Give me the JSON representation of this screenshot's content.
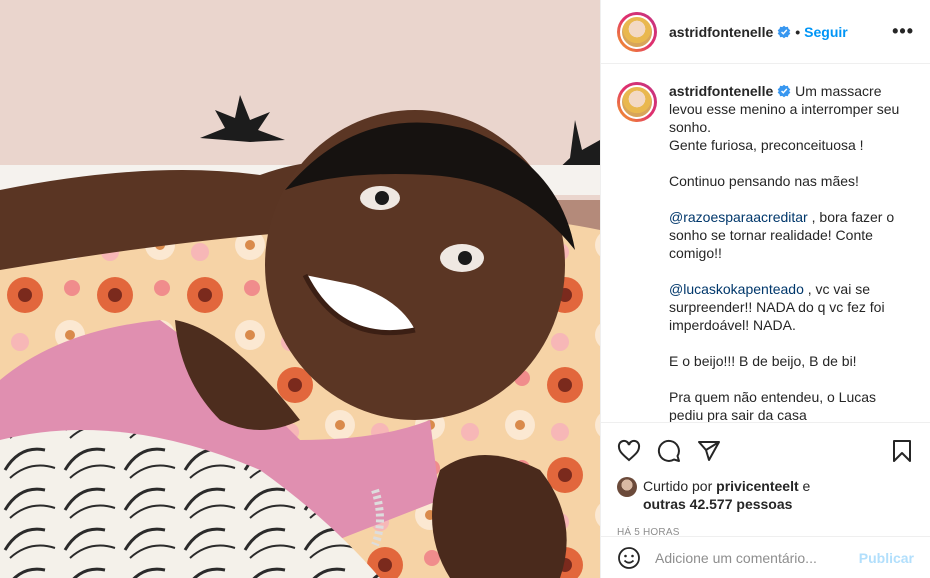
{
  "header": {
    "username": "astridfontenelle",
    "separator": "•",
    "follow_label": "Seguir",
    "more_label": "•••"
  },
  "caption": {
    "username": "astridfontenelle",
    "paragraphs": [
      "Um massacre levou esse menino a interromper seu sonho.\nGente furiosa, preconceituosa !",
      "Continuo pensando nas mães!",
      "@razoesparaacreditar , bora fazer o sonho se tornar realidade! Conte comigo!!",
      "@lucaskokapenteado , vc vai se surpreender!! NADA do q vc fez foi imperdoável! NADA.",
      "E o beijo!!! B de beijo, B de bi!",
      "Pra quem não entendeu, o Lucas pediu pra sair da casa"
    ],
    "p1_line1": "Um massacre levou esse menino a interromper seu sonho.",
    "p1_line2": "Gente furiosa, preconceituosa !",
    "p2": "Continuo pensando nas mães!",
    "p3_mention": "@razoesparaacreditar",
    "p3_rest": " , bora fazer o sonho se tornar realidade! Conte comigo!!",
    "p4_mention": "@lucaskokapenteado",
    "p4_rest": " , vc vai se surpreender!! NADA do q vc fez foi imperdoável! NADA.",
    "p5": "E o beijo!!! B de beijo, B de bi!",
    "p6": "Pra quem não entendeu, o Lucas pediu pra sair da casa"
  },
  "actions": {
    "icons": [
      "heart-icon",
      "comment-icon",
      "share-icon",
      "bookmark-icon"
    ]
  },
  "likes": {
    "prefix": "Curtido por ",
    "user": "privicenteelt",
    "mid": " e",
    "others": "outras 42.577 pessoas"
  },
  "timestamp": "HÁ 5 HORAS",
  "comment": {
    "placeholder": "Adicione um comentário...",
    "publish_label": "Publicar"
  },
  "colors": {
    "link_blue": "#0095f6",
    "mention": "#00376b",
    "publish_disabled": "#b2dffc",
    "muted": "#8e8e8e"
  }
}
